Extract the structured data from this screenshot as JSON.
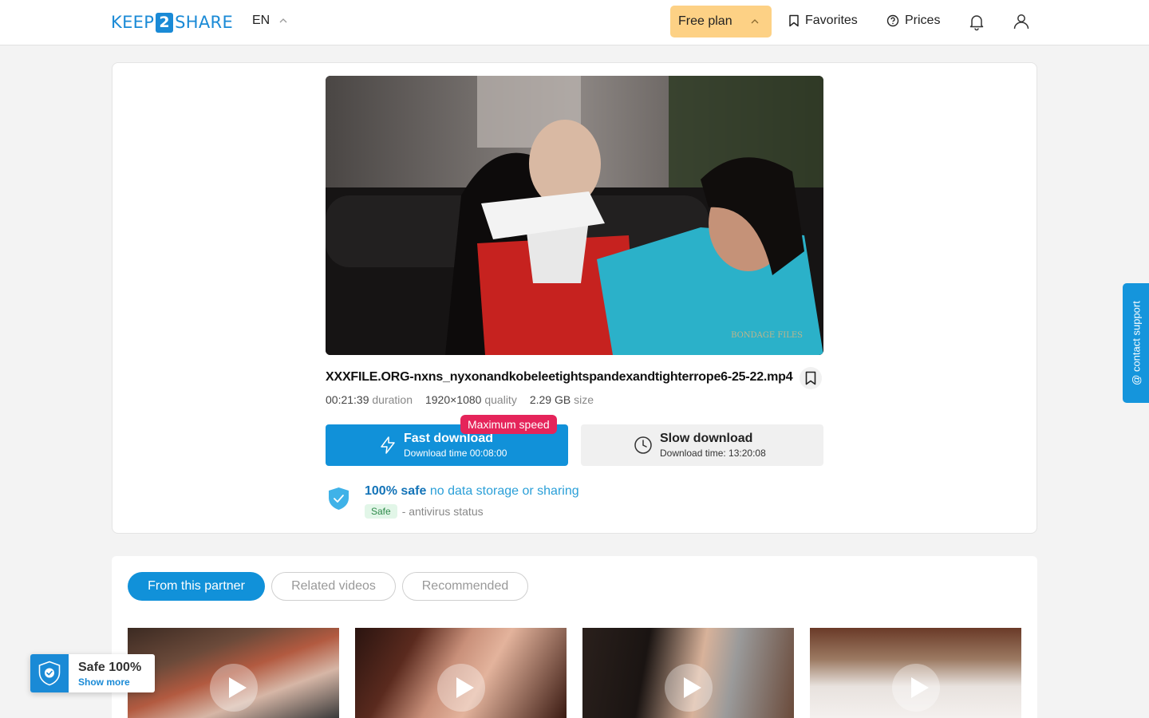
{
  "header": {
    "logo": {
      "left": "KEEP",
      "mid": "2",
      "right": "SHARE"
    },
    "language": "EN",
    "plan_label": "Free plan",
    "favorites_label": "Favorites",
    "prices_label": "Prices"
  },
  "file": {
    "name": "XXXFILE.ORG-nxns_nyxonandkobeleetightspandexandtighterrope6-25-22.mp4",
    "duration_value": "00:21:39",
    "duration_label": "duration",
    "quality_value": "1920×1080",
    "quality_label": "quality",
    "size_value": "2.29 GB",
    "size_label": "size",
    "watermark": "BONDAGE FILES"
  },
  "download": {
    "fast_title": "Fast download",
    "fast_sub": "Download time 00:08:00",
    "max_badge": "Maximum speed",
    "slow_title": "Slow download",
    "slow_sub": "Download time: 13:20:08"
  },
  "safety": {
    "strong": "100% safe",
    "rest": "no data storage or sharing",
    "av_badge": "Safe",
    "av_text": "- antivirus status"
  },
  "support": {
    "label": "@ contact support"
  },
  "tabs": [
    {
      "label": "From this partner",
      "active": true
    },
    {
      "label": "Related videos",
      "active": false
    },
    {
      "label": "Recommended",
      "active": false
    }
  ],
  "safe_widget": {
    "title": "Safe 100%",
    "link": "Show more"
  },
  "colors": {
    "brand": "#1a8ad6",
    "primary_button": "#1191d9",
    "plan_button": "#fdd185",
    "badge": "#e5245a"
  }
}
